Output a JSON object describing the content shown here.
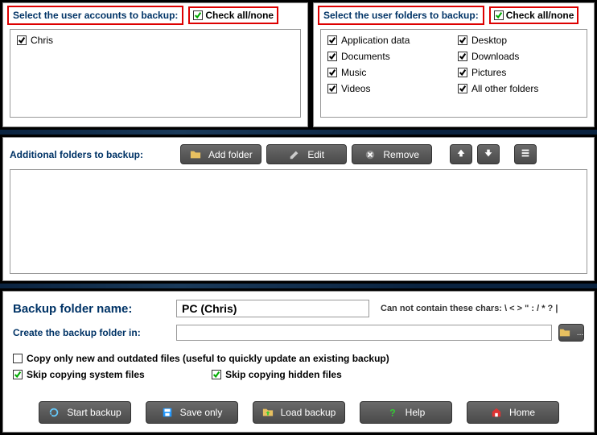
{
  "accounts": {
    "title": "Select the user accounts to backup:",
    "check_all": "Check all/none",
    "items": [
      {
        "label": "Chris"
      }
    ]
  },
  "folders": {
    "title": "Select the user folders to backup:",
    "check_all": "Check all/none",
    "items": [
      {
        "label": "Application data"
      },
      {
        "label": "Desktop"
      },
      {
        "label": "Documents"
      },
      {
        "label": "Downloads"
      },
      {
        "label": "Music"
      },
      {
        "label": "Pictures"
      },
      {
        "label": "Videos"
      },
      {
        "label": "All other folders"
      }
    ]
  },
  "additional": {
    "title": "Additional folders to backup:",
    "buttons": {
      "add": "Add folder",
      "edit": "Edit",
      "remove": "Remove"
    }
  },
  "backup_name": {
    "label": "Backup folder name:",
    "value": "PC (Chris)",
    "hint": "Can not contain these chars: \\ < > \" : / * ? |"
  },
  "create_in": {
    "label": "Create the backup folder in:",
    "value": "",
    "browse": "..."
  },
  "options": {
    "copy_new": "Copy only new and outdated files (useful to quickly update an existing backup)",
    "skip_system": "Skip copying system files",
    "skip_hidden": "Skip copying hidden files"
  },
  "bottom": {
    "start": "Start backup",
    "save": "Save only",
    "load": "Load backup",
    "help": "Help",
    "home": "Home"
  }
}
